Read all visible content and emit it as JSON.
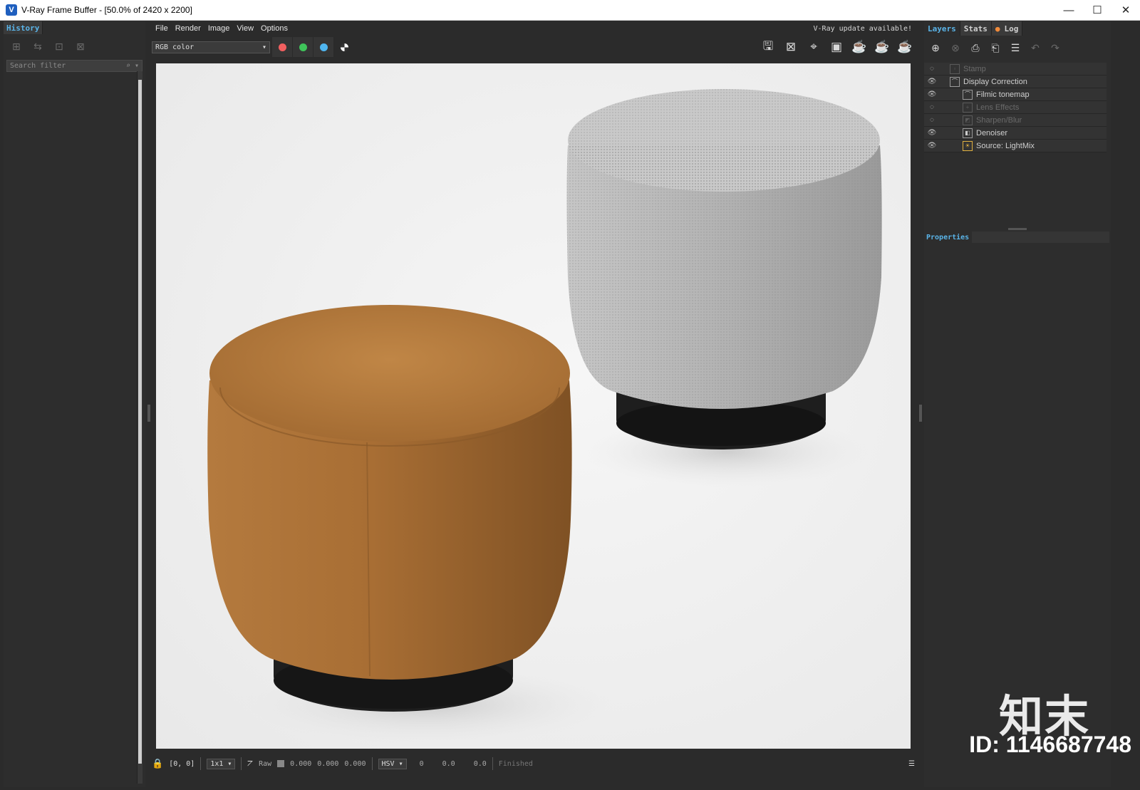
{
  "window": {
    "title": "V-Ray Frame Buffer - [50.0% of 2420 x 2200]",
    "minimize": "—",
    "maximize": "☐",
    "close": "✕"
  },
  "history": {
    "tab": "History",
    "search_placeholder": "Search filter"
  },
  "menu": {
    "items": [
      "File",
      "Render",
      "Image",
      "View",
      "Options"
    ],
    "update_notice": "V-Ray update available!"
  },
  "toolbar": {
    "channel": "RGB color",
    "colors": {
      "red": "#f25f5f",
      "green": "#3fc45a",
      "blue": "#4fb6f0"
    }
  },
  "status": {
    "coords": "[0, 0]",
    "sample": "1x1",
    "mode": "Raw",
    "v1": "0.000",
    "v2": "0.000",
    "v3": "0.000",
    "colorspace": "HSV",
    "h": "0",
    "s": "0.0",
    "v": "0.0",
    "state": "Finished"
  },
  "right": {
    "tabs": [
      "Layers",
      "Stats",
      "Log"
    ],
    "layers": [
      {
        "label": "Stamp",
        "dim": true,
        "indent": 0
      },
      {
        "label": "Display Correction",
        "dim": false,
        "indent": 0
      },
      {
        "label": "Filmic tonemap",
        "dim": false,
        "indent": 1
      },
      {
        "label": "Lens Effects",
        "dim": true,
        "indent": 1
      },
      {
        "label": "Sharpen/Blur",
        "dim": true,
        "indent": 1
      },
      {
        "label": "Denoiser",
        "dim": false,
        "indent": 1
      },
      {
        "label": "Source: LightMix",
        "dim": false,
        "indent": 1
      }
    ],
    "properties_label": "Properties"
  },
  "brand": {
    "name": "知末",
    "id": "ID: 1146687748"
  }
}
